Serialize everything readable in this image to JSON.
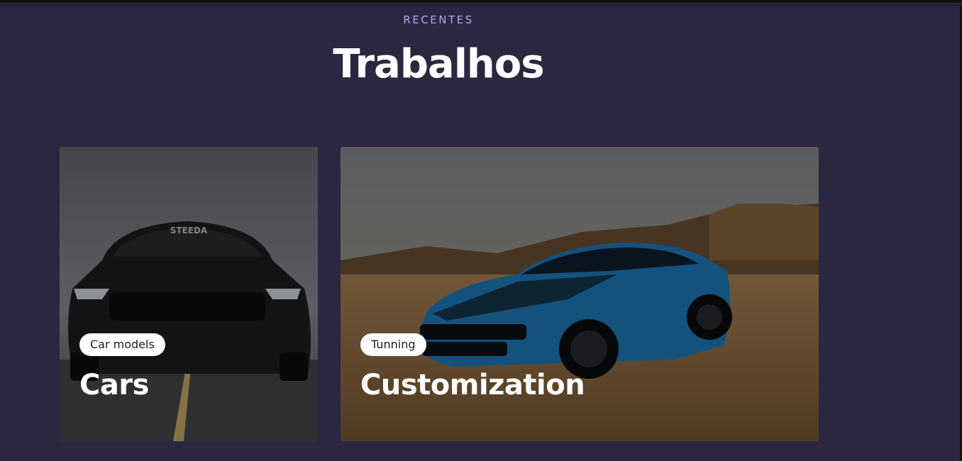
{
  "section": {
    "eyebrow": "RECENTES",
    "title": "Trabalhos"
  },
  "cards": [
    {
      "tag": "Car models",
      "heading": "Cars",
      "image": "black-muscle-car-on-road-photo"
    },
    {
      "tag": "Tunning",
      "heading": "Customization",
      "image": "blue-sports-car-in-desert-photo"
    }
  ],
  "colors": {
    "background": "#2c2740",
    "eyebrow": "#b6a6f0",
    "title": "#ffffff",
    "tag_bg": "#ffffff",
    "tag_text": "#1f1b2e"
  }
}
